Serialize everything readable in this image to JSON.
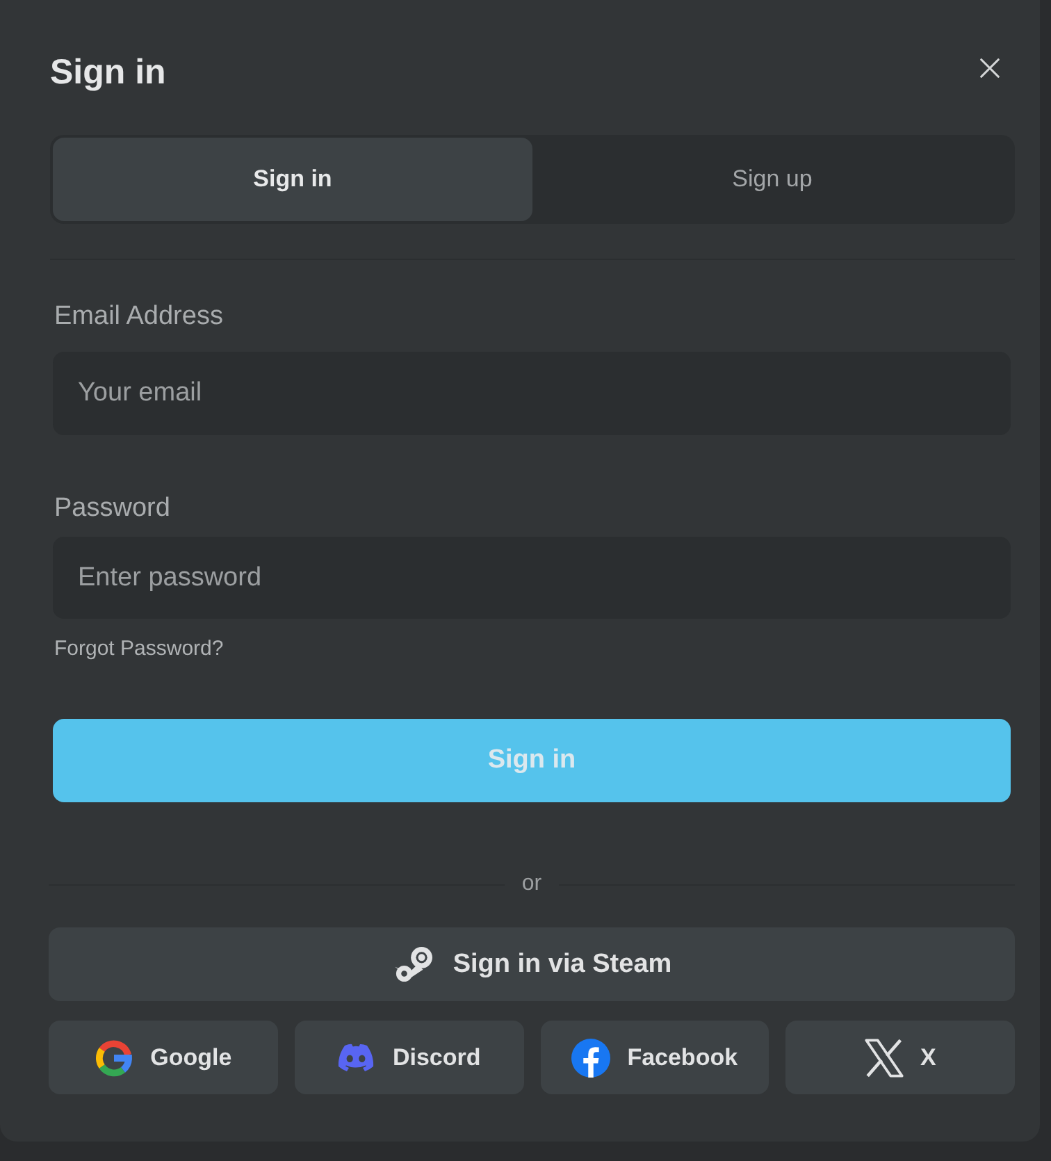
{
  "dialog": {
    "title": "Sign in"
  },
  "tabs": [
    {
      "label": "Sign in",
      "selected": true
    },
    {
      "label": "Sign up",
      "selected": false
    }
  ],
  "fields": [
    {
      "label": "Email Address",
      "placeholder": "Your email"
    },
    {
      "label": "Password",
      "placeholder": "Enter password"
    }
  ],
  "forgot_link": "Forgot Password?",
  "submit_button": "Sign in",
  "divider_text": "or",
  "steam_button": "Sign in via Steam",
  "social_buttons": [
    {
      "kind": "google",
      "label": "Google"
    },
    {
      "kind": "discord",
      "label": "Discord"
    },
    {
      "kind": "facebook",
      "label": "Facebook"
    },
    {
      "kind": "x",
      "label": "X"
    }
  ]
}
